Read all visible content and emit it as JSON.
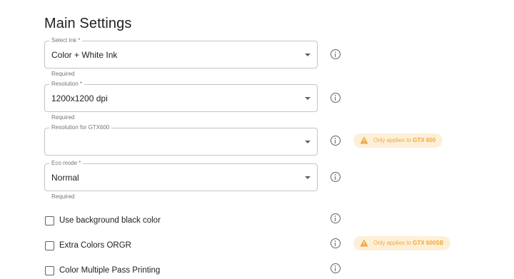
{
  "header": {
    "title": "Main Settings"
  },
  "fields": {
    "ink": {
      "label": "Select Ink *",
      "value": "Color + White Ink",
      "helper": "Required"
    },
    "resolution": {
      "label": "Resolution *",
      "value": "1200x1200 dpi",
      "helper": "Required"
    },
    "resolution_gtx": {
      "label": "Resolution for GTX600",
      "value": ""
    },
    "eco": {
      "label": "Eco mode *",
      "value": "Normal",
      "helper": "Required"
    }
  },
  "chips": {
    "gtx600": {
      "prefix": "Only applies to ",
      "model": "GTX 600",
      "color": "#f2a53c",
      "bg": "#fdf0d8"
    },
    "gtx600sb": {
      "prefix": "Only applies to ",
      "model": "GTX 600SB",
      "color": "#f2a53c",
      "bg": "#fdf0d8"
    }
  },
  "checkboxes": [
    {
      "label": "Use background black color",
      "checked": false
    },
    {
      "label": "Extra Colors ORGR",
      "checked": false
    },
    {
      "label": "Color Multiple Pass Printing",
      "checked": false
    }
  ],
  "icons": {
    "info": "info-circle-icon",
    "warning": "warning-triangle-icon",
    "dropdown": "caret-down-icon"
  }
}
